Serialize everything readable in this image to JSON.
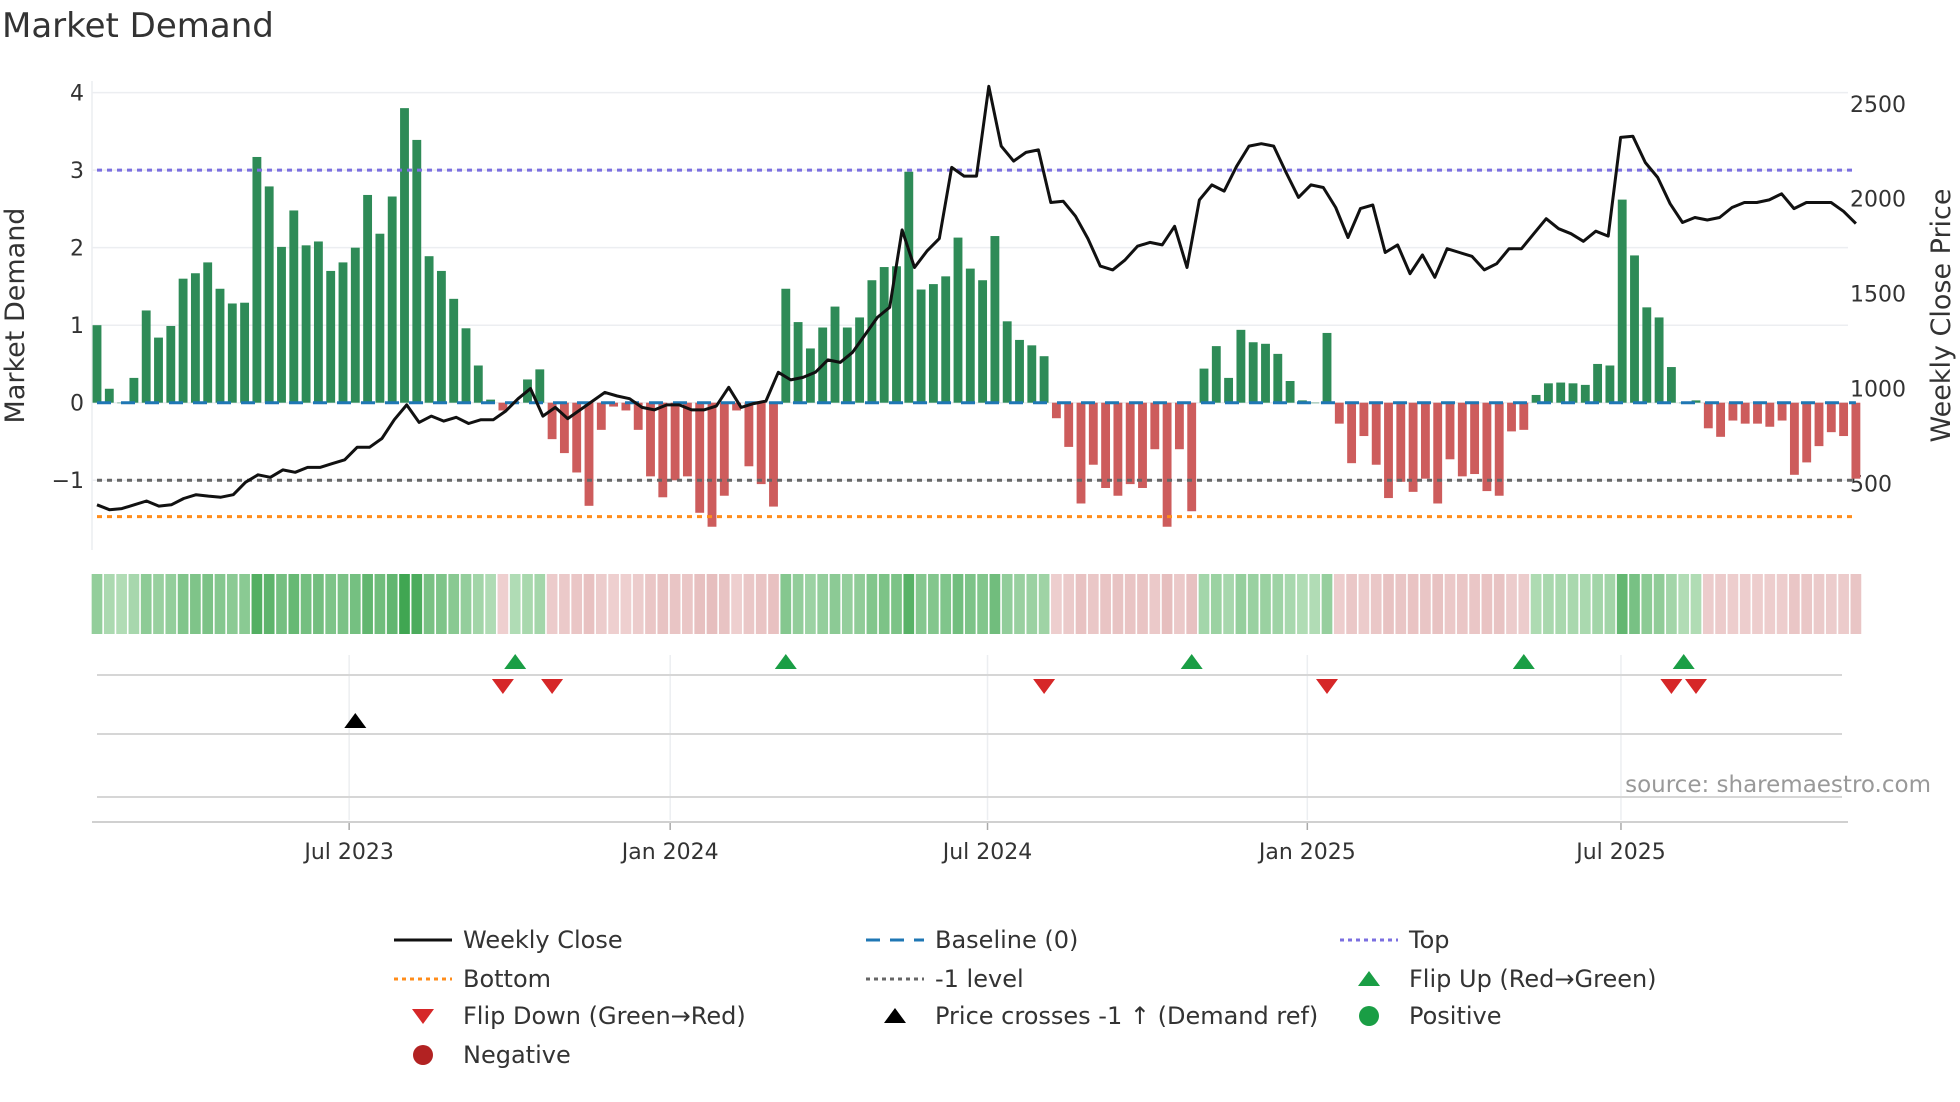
{
  "chart_data": {
    "type": "bar",
    "title": "Market Demand",
    "ylabel": "Market Demand",
    "y2label": "Weekly Close Price",
    "ylim": [
      -1.9,
      4.15
    ],
    "y2lim": [
      150,
      2620
    ],
    "yticks": [
      {
        "v": 4,
        "label": "4"
      },
      {
        "v": 3,
        "label": "3"
      },
      {
        "v": 2,
        "label": "2"
      },
      {
        "v": 1,
        "label": "1"
      },
      {
        "v": 0,
        "label": "0"
      },
      {
        "v": -1,
        "label": "−1"
      }
    ],
    "y2ticks": [
      {
        "v": 2500,
        "label": "2500"
      },
      {
        "v": 2000,
        "label": "2000"
      },
      {
        "v": 1500,
        "label": "1500"
      },
      {
        "v": 1000,
        "label": "1000"
      },
      {
        "v": 500,
        "label": "500"
      }
    ],
    "xticks": [
      {
        "week": 20.5,
        "label": "Jul 2023"
      },
      {
        "week": 46.6,
        "label": "Jan 2024"
      },
      {
        "week": 72.4,
        "label": "Jul 2024"
      },
      {
        "week": 98.4,
        "label": "Jan 2025"
      },
      {
        "week": 123.9,
        "label": "Jul 2025"
      }
    ],
    "demand": [
      1.0,
      0.18,
      0,
      0.32,
      1.19,
      0.84,
      0.99,
      1.6,
      1.67,
      1.81,
      1.47,
      1.28,
      1.29,
      3.17,
      2.79,
      2.01,
      2.48,
      2.03,
      2.08,
      1.7,
      1.81,
      2.0,
      2.68,
      2.18,
      2.66,
      3.8,
      3.39,
      1.89,
      1.7,
      1.34,
      0.96,
      0.48,
      0.04,
      -0.1,
      0.01,
      0.3,
      0.43,
      -0.47,
      -0.65,
      -0.9,
      -1.33,
      -0.35,
      -0.05,
      -0.1,
      -0.35,
      -0.95,
      -1.22,
      -1.0,
      -0.95,
      -1.42,
      -1.6,
      -1.2,
      -0.1,
      -0.82,
      -1.05,
      -1.34,
      1.47,
      1.04,
      0.7,
      0.97,
      1.24,
      0.97,
      1.1,
      1.58,
      1.75,
      1.76,
      2.98,
      1.46,
      1.53,
      1.63,
      2.13,
      1.73,
      1.58,
      2.15,
      1.05,
      0.81,
      0.74,
      0.6,
      -0.2,
      -0.57,
      -1.3,
      -0.8,
      -1.1,
      -1.2,
      -1.05,
      -1.1,
      -0.6,
      -1.6,
      -0.6,
      -1.4,
      0.44,
      0.73,
      0.32,
      0.94,
      0.78,
      0.76,
      0.63,
      0.28,
      0.03,
      0.0,
      0.9,
      -0.27,
      -0.78,
      -0.43,
      -0.8,
      -1.23,
      -1.02,
      -1.15,
      -0.98,
      -1.3,
      -0.73,
      -0.95,
      -0.92,
      -1.14,
      -1.2,
      -0.37,
      -0.35,
      0.1,
      0.25,
      0.26,
      0.25,
      0.23,
      0.5,
      0.48,
      2.62,
      1.9,
      1.23,
      1.1,
      0.46,
      0.0,
      0.03,
      -0.33,
      -0.44,
      -0.23,
      -0.27,
      -0.27,
      -0.31,
      -0.23,
      -0.93,
      -0.77,
      -0.56,
      -0.38,
      -0.43,
      -0.98
    ],
    "weekly_close": [
      388,
      362,
      368,
      388,
      408,
      381,
      388,
      421,
      441,
      434,
      428,
      441,
      507,
      546,
      533,
      572,
      559,
      585,
      585,
      605,
      625,
      691,
      691,
      737,
      836,
      914,
      822,
      855,
      829,
      849,
      816,
      836,
      836,
      882,
      947,
      1000,
      855,
      901,
      842,
      888,
      934,
      980,
      961,
      947,
      901,
      888,
      914,
      914,
      888,
      888,
      908,
      1007,
      901,
      921,
      934,
      1086,
      1046,
      1059,
      1086,
      1151,
      1138,
      1191,
      1283,
      1375,
      1428,
      1836,
      1638,
      1724,
      1790,
      2165,
      2119,
      2119,
      2592,
      2277,
      2198,
      2244,
      2257,
      1980,
      1987,
      1908,
      1790,
      1645,
      1625,
      1678,
      1750,
      1770,
      1757,
      1855,
      1638,
      1994,
      2073,
      2040,
      2171,
      2277,
      2290,
      2277,
      2138,
      2007,
      2073,
      2059,
      1954,
      1796,
      1948,
      1967,
      1717,
      1757,
      1605,
      1704,
      1586,
      1737,
      1717,
      1697,
      1625,
      1658,
      1737,
      1737,
      1816,
      1895,
      1842,
      1816,
      1776,
      1829,
      1803,
      2323,
      2329,
      2191,
      2112,
      1974,
      1875,
      1901,
      1888,
      1901,
      1954,
      1980,
      1980,
      1994,
      2026,
      1948,
      1980,
      1980,
      1980,
      1934,
      1869
    ],
    "levels": {
      "top": 3.0,
      "bottom": -1.47,
      "minus_one": -1.0,
      "baseline": 0
    },
    "flip_up_weeks": [
      34,
      56,
      89,
      116,
      129
    ],
    "flip_down_weeks": [
      33,
      37,
      77,
      100,
      128,
      130
    ],
    "price_cross_weeks": [
      21
    ],
    "colors": {
      "pos": "#2e8b57",
      "neg": "#cd5c5c",
      "price": "#111111",
      "top": "#7b6fe0",
      "bottom": "#ff8c1a",
      "minus_one": "#666666",
      "baseline": "#1f77b4",
      "flip_up": "#1a9e45",
      "flip_down": "#d62728",
      "cross": "#000000",
      "negative_dot": "#b22222"
    },
    "legend": [
      {
        "label": "Weekly Close",
        "kind": "line",
        "color": "#111111",
        "dash": ""
      },
      {
        "label": "Baseline (0)",
        "kind": "line",
        "color": "#1f77b4",
        "dash": "14,10"
      },
      {
        "label": "Top",
        "kind": "line",
        "color": "#7b6fe0",
        "dash": "4,4"
      },
      {
        "label": "Bottom",
        "kind": "line",
        "color": "#ff8c1a",
        "dash": "4,4"
      },
      {
        "label": "-1 level",
        "kind": "line",
        "color": "#666666",
        "dash": "4,4"
      },
      {
        "label": "Flip Up (Red→Green)",
        "kind": "up",
        "color": "#1a9e45"
      },
      {
        "label": "Flip Down (Green→Red)",
        "kind": "down",
        "color": "#d62728"
      },
      {
        "label": "Price crosses -1 ↑ (Demand ref)",
        "kind": "up",
        "color": "#000000"
      },
      {
        "label": "Positive",
        "kind": "dot",
        "color": "#1a9e45"
      },
      {
        "label": "Negative",
        "kind": "dot",
        "color": "#b22222"
      }
    ],
    "source": "source: sharemaestro.com"
  }
}
